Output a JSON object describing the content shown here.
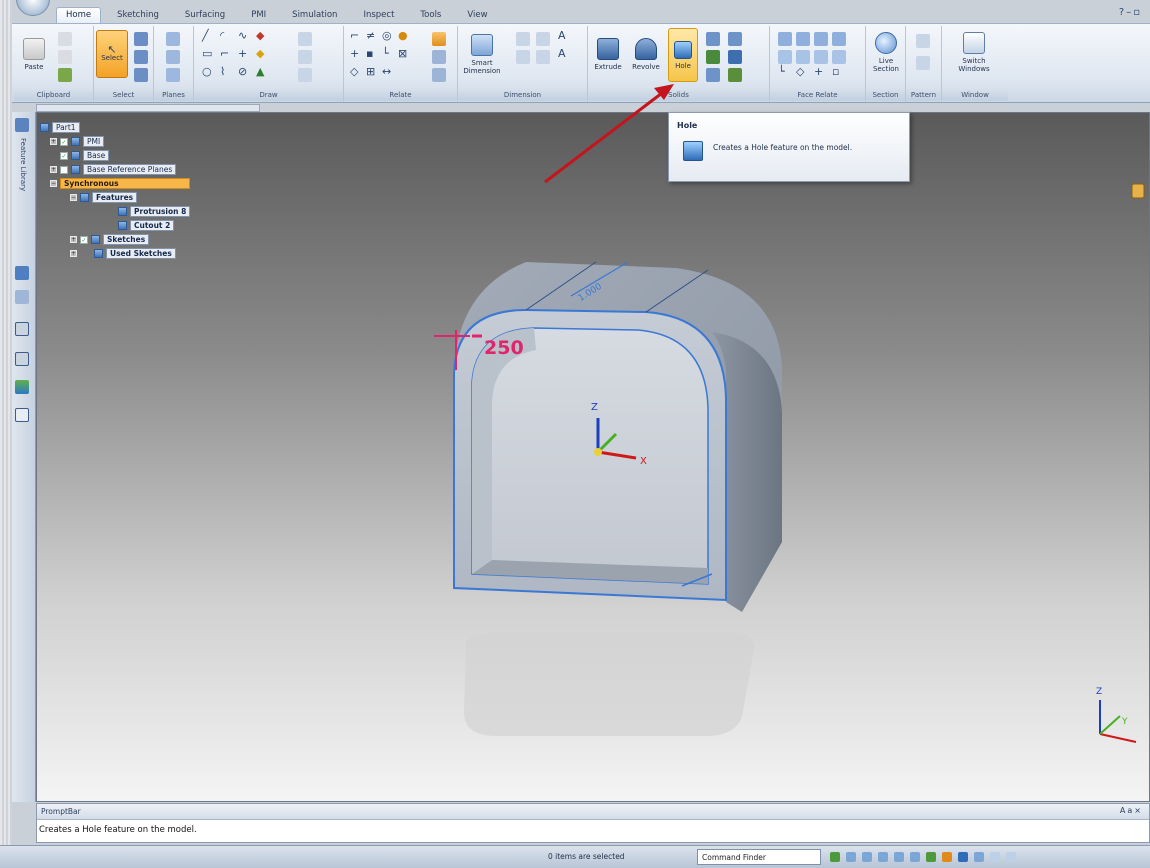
{
  "tabs": [
    {
      "label": "Home",
      "active": true
    },
    {
      "label": "Sketching"
    },
    {
      "label": "Surfacing"
    },
    {
      "label": "PMI"
    },
    {
      "label": "Simulation"
    },
    {
      "label": "Inspect"
    },
    {
      "label": "Tools"
    },
    {
      "label": "View"
    }
  ],
  "ribbon": {
    "groups": [
      "Clipboard",
      "Select",
      "Planes",
      "Draw",
      "Relate",
      "Dimension",
      "Solids",
      "Face Relate",
      "Section",
      "Pattern",
      "Window"
    ],
    "buttons": {
      "paste": "Paste",
      "select": "Select",
      "smart_dimension": "Smart Dimension",
      "extrude": "Extrude",
      "revolve": "Revolve",
      "hole": "Hole",
      "live_section": "Live Section",
      "switch_windows": "Switch Windows"
    }
  },
  "tree": {
    "items": [
      {
        "label": "Part1"
      },
      {
        "label": "PMI"
      },
      {
        "label": "Base"
      },
      {
        "label": "Base Reference Planes"
      },
      {
        "label": "Synchronous"
      },
      {
        "label": "Features"
      },
      {
        "label": "Protrusion 8"
      },
      {
        "label": "Cutout 2"
      },
      {
        "label": "Sketches"
      },
      {
        "label": "Used Sketches"
      }
    ]
  },
  "side": {
    "feature_library": "Feature Library"
  },
  "tooltip": {
    "title": "Hole",
    "text": "Creates a Hole feature on the model."
  },
  "model": {
    "dimension": "250",
    "dimension_top": "1.000",
    "triad": {
      "z": "Z",
      "x": "X",
      "y": "Y"
    }
  },
  "promptbar": {
    "title": "PromptBar",
    "text": "Creates a Hole feature on the model."
  },
  "status": {
    "selection": "0 items are selected",
    "command_finder": "Command Finder"
  },
  "colors": {
    "model_edge": "#3a78d4",
    "dimension": "#e0256d",
    "arrow": "#c4141c",
    "selected_node": "#f7b64a"
  }
}
